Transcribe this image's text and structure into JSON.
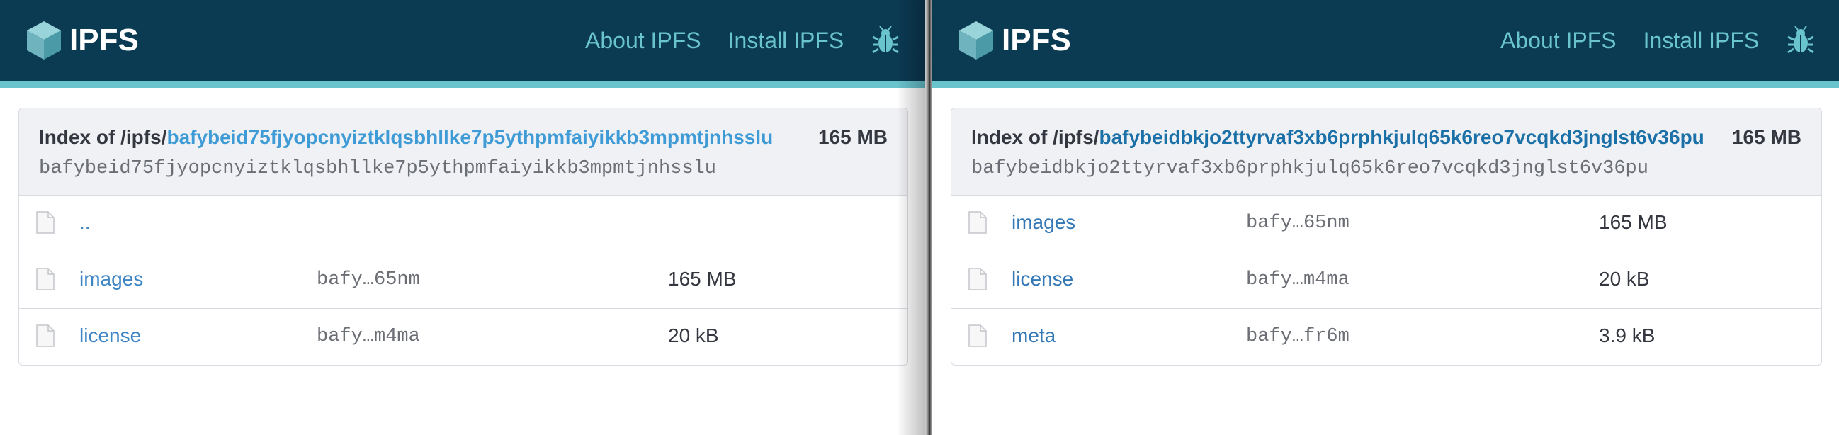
{
  "colors": {
    "header_bg": "#0b3a53",
    "header_accent": "#69c4cd",
    "nav_link": "#69c4cd",
    "link": "#3479b6",
    "card_head_bg": "#f0f1f5"
  },
  "panes": [
    {
      "header": {
        "logo_text": "IPFS",
        "nav": [
          "About IPFS",
          "Install IPFS"
        ],
        "bug_icon": "bug-icon"
      },
      "index": {
        "prefix": "Index of /ipfs/",
        "cid": "bafybeid75fjyopcnyiztklqsbhllke7p5ythpmfaiyikkb3mpmtjnhsslu",
        "total_size": "165 MB",
        "cid_mono": "bafybeid75fjyopcnyiztklqsbhllke7p5ythpmfaiyikkb3mpmtjnhsslu"
      },
      "rows": [
        {
          "name": "..",
          "cid": "",
          "size": ""
        },
        {
          "name": "images",
          "cid": "bafy…65nm",
          "size": "165 MB"
        },
        {
          "name": "license",
          "cid": "bafy…m4ma",
          "size": "20 kB"
        }
      ]
    },
    {
      "header": {
        "logo_text": "IPFS",
        "nav": [
          "About IPFS",
          "Install IPFS"
        ],
        "bug_icon": "bug-icon"
      },
      "index": {
        "prefix": "Index of /ipfs/",
        "cid": "bafybeidbkjo2ttyrvaf3xb6prphkjulq65k6reo7vcqkd3jnglst6v36pu",
        "total_size": "165 MB",
        "cid_mono": "bafybeidbkjo2ttyrvaf3xb6prphkjulq65k6reo7vcqkd3jnglst6v36pu"
      },
      "rows": [
        {
          "name": "images",
          "cid": "bafy…65nm",
          "size": "165 MB"
        },
        {
          "name": "license",
          "cid": "bafy…m4ma",
          "size": "20 kB"
        },
        {
          "name": "meta",
          "cid": "bafy…fr6m",
          "size": "3.9 kB"
        }
      ]
    }
  ]
}
